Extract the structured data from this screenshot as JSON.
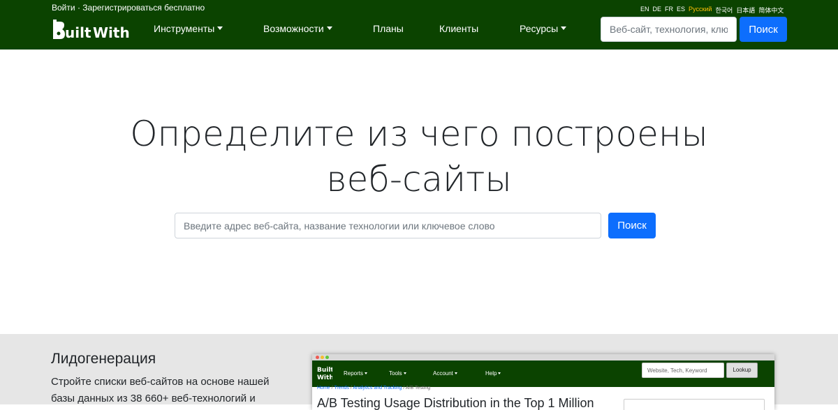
{
  "header": {
    "login": "Войти",
    "separator": "·",
    "register": "Зарегистрироваться бесплатно",
    "logo_text": "Built With",
    "languages": [
      "EN",
      "DE",
      "FR",
      "ES",
      "Русский",
      "한국어",
      "日本語",
      "简体中文"
    ],
    "active_language": "Русский",
    "menu": {
      "tools": "Инструменты",
      "features": "Возможности",
      "plans": "Планы",
      "customers": "Клиенты",
      "resources": "Ресурсы"
    },
    "search_placeholder": "Веб-сайт, технология, ключевое слово",
    "search_button": "Поиск"
  },
  "hero": {
    "headline_line1": "Определите из чего построены",
    "headline_line2": "веб-сайты",
    "input_placeholder": "Введите адрес веб-сайта, название технологии или ключевое слово",
    "search_button": "Поиск"
  },
  "lead": {
    "title": "Лидогенерация",
    "text": "Стройте списки веб-сайтов на основе нашей базы данных из 38 660+ веб-технологий и"
  },
  "preview": {
    "menu": [
      "Reports",
      "Tools",
      "Account",
      "Help"
    ],
    "search_placeholder": "Website, Tech, Keyword",
    "lookup_button": "Lookup",
    "breadcrumb": [
      "Home",
      "Trends",
      "Analytics and Tracking",
      "A/B Testing"
    ],
    "title": "A/B Testing Usage Distribution in the Top 1 Million"
  },
  "colors": {
    "nav_bg": "#0b4300",
    "primary_button": "#0d6efd",
    "active_language": "#ffc107",
    "lower_bg": "#e6e6e6"
  }
}
